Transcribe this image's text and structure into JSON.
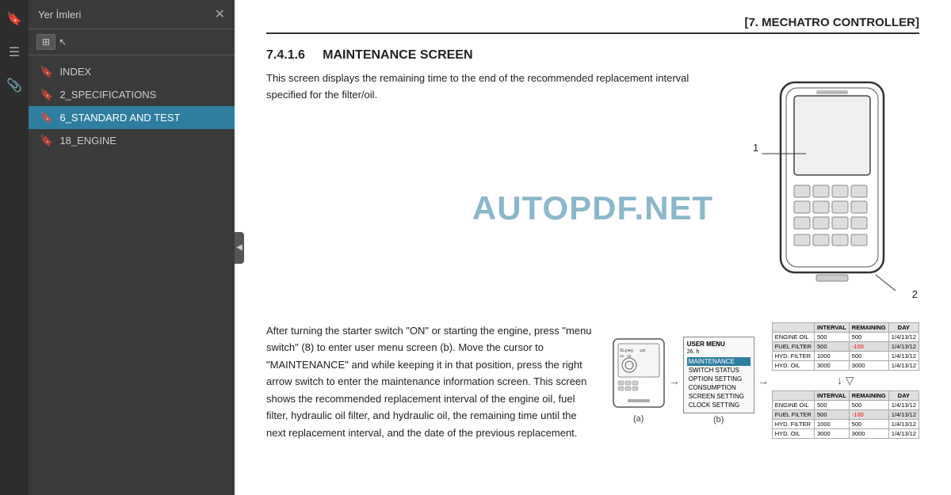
{
  "sidebar": {
    "title": "Yer İmleri",
    "close_label": "✕",
    "toolbar_icon": "⊞",
    "bookmarks": [
      {
        "id": "index",
        "label": "INDEX",
        "active": false
      },
      {
        "id": "specs",
        "label": "2_SPECIFICATIONS",
        "active": false
      },
      {
        "id": "standard",
        "label": "6_STANDARD AND TEST",
        "active": true
      },
      {
        "id": "engine",
        "label": "18_ENGINE",
        "active": false
      }
    ]
  },
  "icons": {
    "bookmarks_panel": "🔖",
    "layers_panel": "☰",
    "attach_panel": "📎"
  },
  "page_header": "[7.  MECHATRO CONTROLLER]",
  "section": {
    "number": "7.4.1.6",
    "title": "MAINTENANCE SCREEN",
    "intro": "This screen displays the remaining time to the end of the recommended replacement interval specified for the filter/oil.",
    "detail": "After turning the starter switch \"ON\" or starting the engine, press \"menu switch\" (8) to enter user menu screen (b). Move the cursor to \"MAINTENANCE\" and while keeping it in that position, press the right arrow switch to enter the maintenance information screen. This screen shows the recommended replacement interval of the engine oil, fuel filter, hydraulic oil filter, and hydraulic oil, the remaining time until the next replacement interval, and the date of the previous replacement."
  },
  "watermark": "AUTOPDF.NET",
  "diagram_labels": {
    "label1": "1",
    "label2": "2",
    "label_a": "(a)",
    "label_b": "(b)"
  },
  "user_menu": {
    "header": "USER MENU",
    "hours": "26. h",
    "items": [
      {
        "label": "MAINTENANCE",
        "selected": true
      },
      {
        "label": "SWITCH STATUS",
        "selected": false
      },
      {
        "label": "OPTION SETTING",
        "selected": false
      },
      {
        "label": "CONSUMPTION",
        "selected": false
      },
      {
        "label": "SCREEN SETTING",
        "selected": false
      },
      {
        "label": "CLOCK SETTING",
        "selected": false
      }
    ]
  },
  "table1": {
    "headers": [
      "",
      "INTERVAL",
      "REMAINING",
      "DAY"
    ],
    "rows": [
      {
        "name": "ENGINE OIL",
        "interval": "500",
        "remaining": "500",
        "day": "1/4/13/12"
      },
      {
        "name": "FUEL FILTER",
        "interval": "500",
        "remaining": "-100",
        "day": "1/4/13/12",
        "highlight": true
      },
      {
        "name": "HYD. FILTER",
        "interval": "1000",
        "remaining": "500",
        "day": "1/4/13/12"
      },
      {
        "name": "HYD. OIL",
        "interval": "3000",
        "remaining": "3000",
        "day": "1/4/13/12"
      }
    ]
  },
  "table2": {
    "headers": [
      "",
      "INTERVAL",
      "REMAINING",
      "DAY"
    ],
    "rows": [
      {
        "name": "ENGINE OIL",
        "interval": "500",
        "remaining": "500",
        "day": "1/4/13/12"
      },
      {
        "name": "FUEL FILTER",
        "interval": "500",
        "remaining": "-100",
        "day": "1/4/13/12",
        "highlight": true
      },
      {
        "name": "HYD. FILTER",
        "interval": "1000",
        "remaining": "500",
        "day": "1/4/13/12"
      },
      {
        "name": "HYD. OIL",
        "interval": "3000",
        "remaining": "3000",
        "day": "1/4/13/12"
      }
    ]
  }
}
